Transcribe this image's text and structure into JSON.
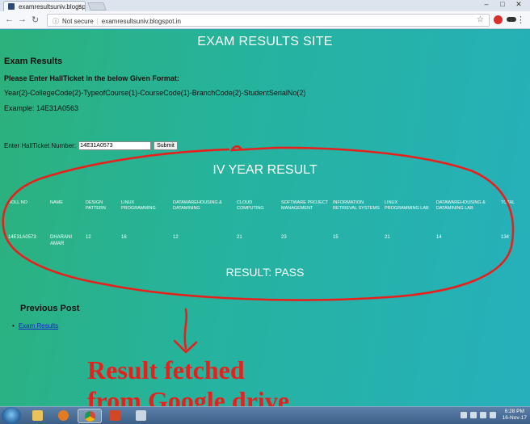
{
  "browser": {
    "tab_title": "examresultsuniv.blogspo",
    "tab_close": "×",
    "security_label": "Not secure",
    "url": "examresultsuniv.blogspot.in",
    "window_buttons": [
      "–",
      "□",
      "✕"
    ]
  },
  "page": {
    "site_title": "EXAM RESULTS SITE",
    "exam_heading": "Exam Results",
    "instruction": "Please Enter HallTicket in the below Given Format:",
    "format": "Year(2)-CollegeCode(2)-TypeofCourse(1)-CourseCode(1)-BranchCode(2)-StudentSerialNo(2)",
    "example": "Example: 14E31A0563",
    "form": {
      "label": "Enter HallTicket Number:",
      "input_value": "14E31A0573",
      "submit_label": "Submit"
    },
    "result_title": "IV YEAR RESULT",
    "table": {
      "headers": [
        "ROLL NO",
        "NAME",
        "DESIGN PATTERN",
        "LINUX PROGRAMMING",
        "DATAWAREHOUSING & DATAMINING",
        "CLOUD COMPUTING",
        "SOFTWARE PROJECT MANAGEMENT",
        "INFORMATION RETRIEVAL SYSTEMS",
        "LINUX PROGRAMMING LAB",
        "DATAWAREHOUSING & DATAMINING LAB",
        "TOTAL"
      ],
      "row": [
        "14E31A0573",
        "DHARANI AMAR",
        "12",
        "16",
        "12",
        "21",
        "23",
        "15",
        "21",
        "14",
        "134"
      ]
    },
    "result_status": "RESULT: PASS",
    "previous_post_heading": "Previous Post",
    "previous_post_link": "Exam Results"
  },
  "annotation": {
    "line1": "Result fetched",
    "line2": "from Google drive",
    "color": "#e8201c"
  },
  "taskbar": {
    "apps": [
      "start-orb",
      "explorer",
      "firefox",
      "chrome",
      "powerpoint",
      "screen-capture"
    ],
    "time": "6:28 PM",
    "date": "16-Nov-17"
  }
}
